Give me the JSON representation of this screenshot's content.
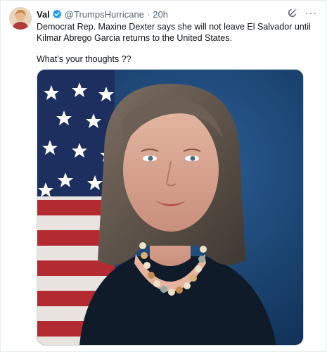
{
  "post": {
    "author_name": "Val",
    "handle": "@TrumpsHurricane",
    "separator": "·",
    "time": "20h",
    "text_line1": "Democrat Rep. Maxine Dexter says she will not leave El Salvador until Kilmar Abrego Garcia returns to the United States.",
    "text_line2": "What’s your thoughts ??",
    "icons": {
      "avatar": "avatar",
      "verified": "verified-badge-icon",
      "grok": "grok-icon",
      "more": "more-options-icon"
    },
    "more_glyph": "···"
  },
  "colors": {
    "verified_blue": "#1d9bf0",
    "muted_text": "#536471"
  }
}
